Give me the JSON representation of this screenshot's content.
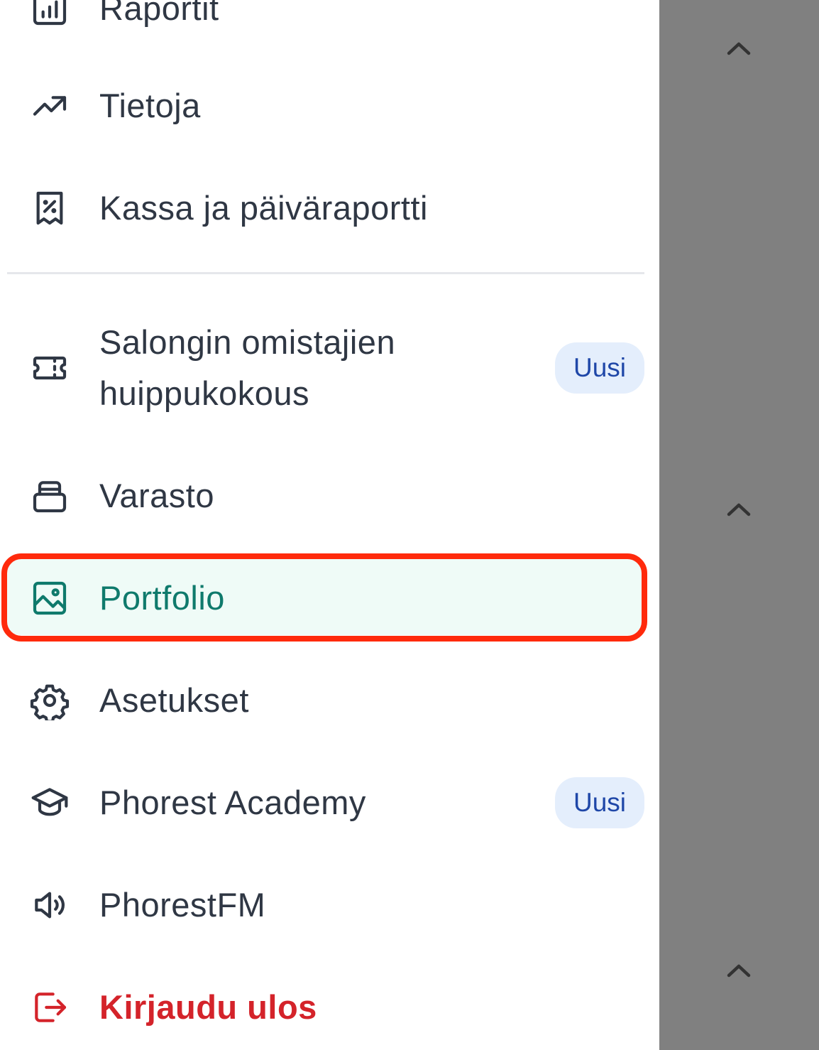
{
  "menu": {
    "items": [
      {
        "key": "raportit",
        "label": "Raportit",
        "icon": "bar-chart-icon"
      },
      {
        "key": "tietoja",
        "label": "Tietoja",
        "icon": "trending-up-icon"
      },
      {
        "key": "kassa",
        "label": "Kassa ja päiväraportti",
        "icon": "receipt-percent-icon"
      },
      {
        "key": "summit",
        "label_line1": "Salongin omistajien",
        "label_line2": "huippukokous",
        "badge": "Uusi",
        "icon": "ticket-icon"
      },
      {
        "key": "varasto",
        "label": "Varasto",
        "icon": "inventory-icon"
      },
      {
        "key": "portfolio",
        "label": "Portfolio",
        "icon": "image-icon",
        "active": true
      },
      {
        "key": "asetukset",
        "label": "Asetukset",
        "icon": "gear-icon"
      },
      {
        "key": "academy",
        "label": "Phorest Academy",
        "badge": "Uusi",
        "icon": "graduation-cap-icon"
      },
      {
        "key": "phorestfm",
        "label": "PhorestFM",
        "icon": "speaker-icon"
      },
      {
        "key": "logout",
        "label": "Kirjaudu ulos",
        "icon": "logout-icon"
      }
    ]
  },
  "colors": {
    "text": "#2f3744",
    "active_text": "#0f7a6c",
    "active_bg": "#effbf7",
    "logout": "#d4232a",
    "badge_bg": "#e4eefc",
    "badge_text": "#1f47a8",
    "overlay": "#808080",
    "highlight": "#ff2a0c"
  }
}
